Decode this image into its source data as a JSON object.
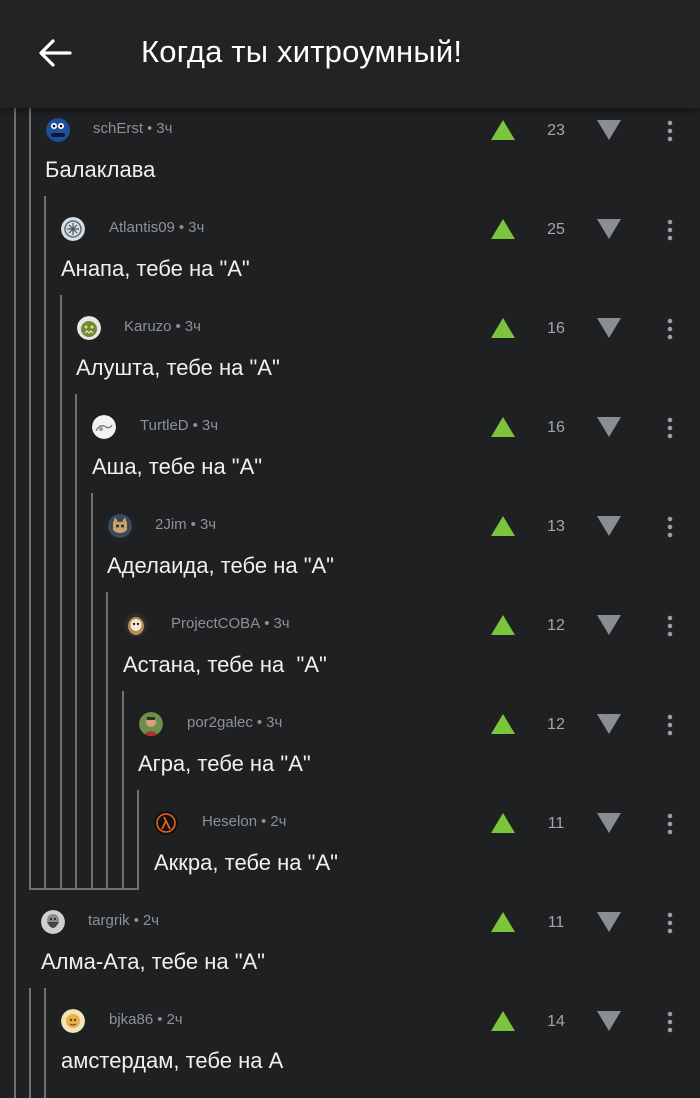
{
  "header": {
    "title": "Когда ты хитроумный!",
    "back_icon": "arrow-left-icon"
  },
  "colors": {
    "background": "#1e2022",
    "upvote": "#7cc43b",
    "downvote": "#8a8e92",
    "text": "#f0f0f0",
    "meta": "#8d9196"
  },
  "comments": [
    {
      "author": "schErst",
      "time": "3ч",
      "score": "23",
      "text": "Балаклава",
      "avatar": "cookie-monster-avatar"
    },
    {
      "author": "Atlantis09",
      "time": "3ч",
      "score": "25",
      "text": "Анапа, тебе на \"А\"",
      "avatar": "emblem-avatar"
    },
    {
      "author": "Karuzo",
      "time": "3ч",
      "score": "16",
      "text": "Алушта, тебе на \"А\"",
      "avatar": "orc-avatar"
    },
    {
      "author": "TurtleD",
      "time": "3ч",
      "score": "16",
      "text": "Аша, тебе на \"А\"",
      "avatar": "sketch-avatar"
    },
    {
      "author": "2Jim",
      "time": "3ч",
      "score": "13",
      "text": "Аделаида, тебе на \"А\"",
      "avatar": "cat-avatar"
    },
    {
      "author": "ProjectCOBA",
      "time": "3ч",
      "score": "12",
      "text": "Астана, тебе на  \"А\"",
      "avatar": "owl-avatar"
    },
    {
      "author": "por2galec",
      "time": "3ч",
      "score": "12",
      "text": "Агра, тебе на \"А\"",
      "avatar": "man-avatar"
    },
    {
      "author": "Heselon",
      "time": "2ч",
      "score": "11",
      "text": "Аккра, тебе на \"А\"",
      "avatar": "lambda-avatar"
    },
    {
      "author": "targrik",
      "time": "2ч",
      "score": "11",
      "text": "Алма-Ата, тебе на \"А\"",
      "avatar": "bearded-man-avatar"
    },
    {
      "author": "bjka86",
      "time": "2ч",
      "score": "14",
      "text": "амстердам, тебе на А",
      "avatar": "cartoon-avatar"
    }
  ]
}
